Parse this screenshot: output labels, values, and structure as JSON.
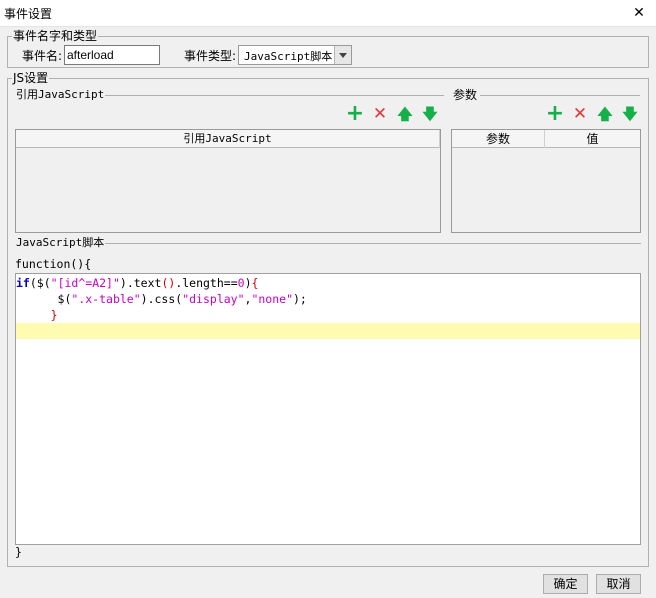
{
  "window": {
    "title": "事件设置",
    "close_glyph": "✕"
  },
  "name_group": {
    "legend": "事件名字和类型",
    "name_label": "事件名:",
    "name_value": "afterload",
    "type_label": "事件类型:",
    "type_value": "JavaScript脚本"
  },
  "js_group": {
    "legend": "JS设置",
    "ref_section": {
      "legend": "引用JavaScript",
      "column": "引用JavaScript",
      "toolbar": {
        "add": "+",
        "delete": "✕",
        "up": "🡅",
        "down": "🡇"
      }
    },
    "param_section": {
      "legend": "参数",
      "columns": [
        "参数",
        "值"
      ],
      "toolbar": {
        "add": "+",
        "delete": "✕",
        "up": "🡅",
        "down": "🡇"
      }
    },
    "script_section": {
      "legend": "JavaScript脚本",
      "header": "function(){",
      "footer": "}",
      "lines": [
        {
          "kw": "if",
          "p1": "(",
          "fn1": "$(",
          "s1": "\"[id^=A2]\"",
          "p2": ").text",
          "b1": "()",
          "p3": ".length==",
          "n1": "0",
          "p4": ")",
          "b2": "{"
        },
        {
          "indent": "      ",
          "fn1": "$(",
          "s1": "\".x-table\"",
          "p2": ").css(",
          "s2": "\"display\"",
          "p3": ",",
          "s3": "\"none\"",
          "p4": ");"
        },
        {
          "indent": "     ",
          "b1": "}"
        }
      ]
    }
  },
  "buttons": {
    "ok": "确定",
    "cancel": "取消"
  }
}
